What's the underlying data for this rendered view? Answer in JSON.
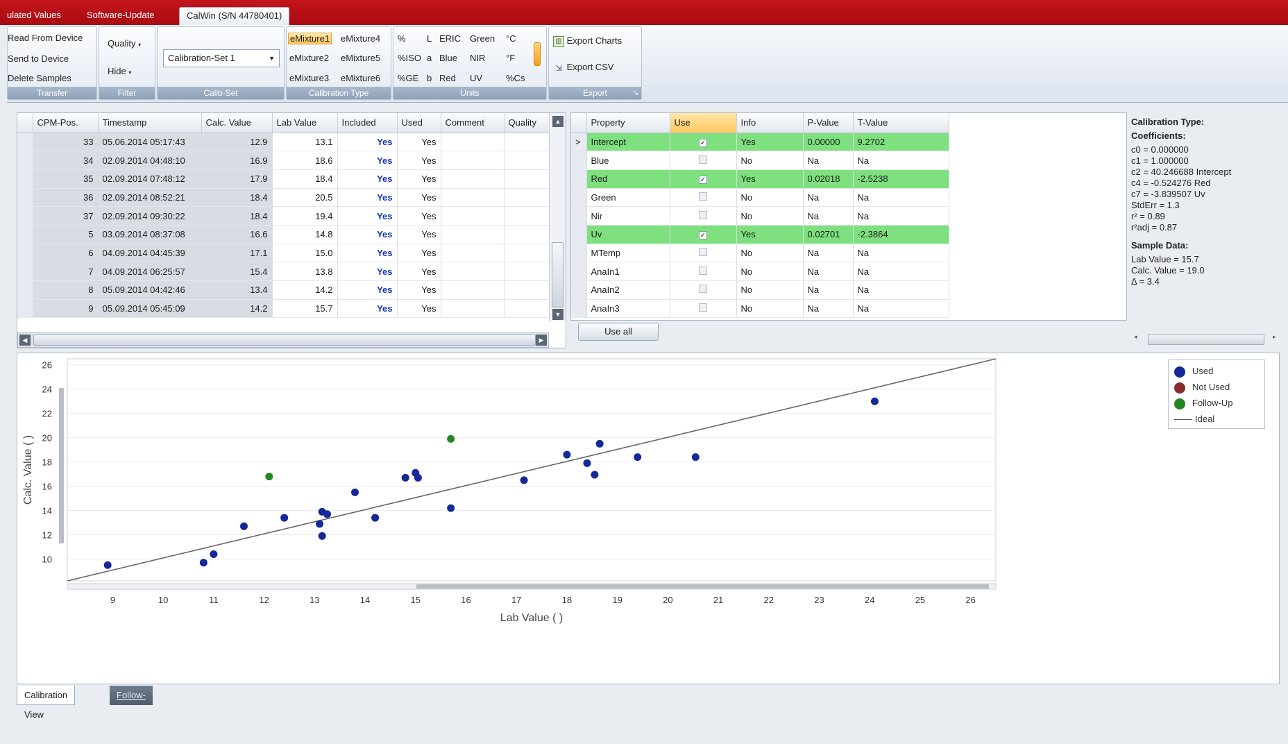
{
  "tabs": [
    {
      "label": "ulated Values"
    },
    {
      "label": "Software-Update"
    },
    {
      "label": "CalWin (S/N 44780401)"
    }
  ],
  "ribbon": {
    "transfer": {
      "items": [
        "Read From Device",
        "Send to Device",
        "Delete Samples"
      ],
      "label": "Transfer"
    },
    "filter": {
      "items": [
        "Quality",
        "Hide"
      ],
      "label": "Filter"
    },
    "calibset": {
      "value": "Calibration-Set 1",
      "label": "Calib-Set"
    },
    "caltype": {
      "items": [
        "eMixture1",
        "eMixture4",
        "eMixture2",
        "eMixture5",
        "eMixture3",
        "eMixture6"
      ],
      "label": "Calibration Type"
    },
    "units": {
      "col1": [
        "%",
        "%ISO",
        "%GE"
      ],
      "col2": [
        "L",
        "a",
        "b"
      ],
      "col3": [
        "ERIC",
        "Blue",
        "Red"
      ],
      "col4": [
        "Green",
        "NIR",
        "UV"
      ],
      "col5": [
        "°C",
        "°F",
        "%Cs"
      ],
      "label": "Units"
    },
    "export": {
      "charts": "Export Charts",
      "csv": "Export CSV",
      "label": "Export"
    }
  },
  "samples": {
    "headers": [
      "CPM-Pos.",
      "Timestamp",
      "Calc. Value",
      "Lab Value",
      "Included",
      "Used",
      "Comment",
      "Quality"
    ],
    "rows": [
      {
        "pos": "33",
        "ts": "05.06.2014 05:17:43",
        "calc": "12.9",
        "lab": "13.1",
        "inc": "Yes",
        "used": "Yes"
      },
      {
        "pos": "34",
        "ts": "02.09.2014 04:48:10",
        "calc": "16.9",
        "lab": "18.6",
        "inc": "Yes",
        "used": "Yes"
      },
      {
        "pos": "35",
        "ts": "02.09.2014 07:48:12",
        "calc": "17.9",
        "lab": "18.4",
        "inc": "Yes",
        "used": "Yes"
      },
      {
        "pos": "36",
        "ts": "02.09.2014 08:52:21",
        "calc": "18.4",
        "lab": "20.5",
        "inc": "Yes",
        "used": "Yes"
      },
      {
        "pos": "37",
        "ts": "02.09.2014 09:30:22",
        "calc": "18.4",
        "lab": "19.4",
        "inc": "Yes",
        "used": "Yes"
      },
      {
        "pos": "5",
        "ts": "03.09.2014 08:37:08",
        "calc": "16.6",
        "lab": "14.8",
        "inc": "Yes",
        "used": "Yes"
      },
      {
        "pos": "6",
        "ts": "04.09.2014 04:45:39",
        "calc": "17.1",
        "lab": "15.0",
        "inc": "Yes",
        "used": "Yes"
      },
      {
        "pos": "7",
        "ts": "04.09.2014 06:25:57",
        "calc": "15.4",
        "lab": "13.8",
        "inc": "Yes",
        "used": "Yes"
      },
      {
        "pos": "8",
        "ts": "05.09.2014 04:42:46",
        "calc": "13.4",
        "lab": "14.2",
        "inc": "Yes",
        "used": "Yes"
      },
      {
        "pos": "9",
        "ts": "05.09.2014 05:45:09",
        "calc": "14.2",
        "lab": "15.7",
        "inc": "Yes",
        "used": "Yes"
      }
    ]
  },
  "properties": {
    "headers": [
      "Property",
      "Use",
      "Info",
      "P-Value",
      "T-Value"
    ],
    "rows": [
      {
        "name": "Intercept",
        "use": true,
        "info": "Yes",
        "p": "0.00000",
        "t": "9.2702",
        "hl": true,
        "cur": true
      },
      {
        "name": "Blue",
        "use": false,
        "info": "No",
        "p": "Na",
        "t": "Na",
        "hl": false
      },
      {
        "name": "Red",
        "use": true,
        "info": "Yes",
        "p": "0.02018",
        "t": "-2.5238",
        "hl": true
      },
      {
        "name": "Green",
        "use": false,
        "info": "No",
        "p": "Na",
        "t": "Na",
        "hl": false
      },
      {
        "name": "Nir",
        "use": false,
        "info": "No",
        "p": "Na",
        "t": "Na",
        "hl": false
      },
      {
        "name": "Uv",
        "use": true,
        "info": "Yes",
        "p": "0.02701",
        "t": "-2.3864",
        "hl": true
      },
      {
        "name": "MTemp",
        "use": false,
        "info": "No",
        "p": "Na",
        "t": "Na",
        "hl": false
      },
      {
        "name": "AnaIn1",
        "use": false,
        "info": "No",
        "p": "Na",
        "t": "Na",
        "hl": false
      },
      {
        "name": "AnaIn2",
        "use": false,
        "info": "No",
        "p": "Na",
        "t": "Na",
        "hl": false
      },
      {
        "name": "AnaIn3",
        "use": false,
        "info": "No",
        "p": "Na",
        "t": "Na",
        "hl": false
      }
    ],
    "use_all": "Use all"
  },
  "coefficients": {
    "title_type": "Calibration Type:",
    "title_coeff": "Coefficients:",
    "lines": [
      "c0 = 0.000000",
      "c1 = 1.000000",
      "c2 = 40.246688 Intercept",
      "c4 = -0.524276 Red",
      "c7 = -3.839507 Uv",
      "StdErr = 1.3",
      "r² = 0.89",
      "r²adj = 0.87"
    ],
    "title_sample": "Sample Data:",
    "sample_lines": [
      "Lab Value = 15.7",
      "Calc. Value = 19.0",
      "Δ = 3.4"
    ]
  },
  "legend": {
    "used": "Used",
    "not_used": "Not Used",
    "follow_up": "Follow-Up",
    "ideal": "Ideal"
  },
  "colors": {
    "used": "#14289a",
    "not_used": "#8b2a2a",
    "follow_up": "#22871f",
    "ideal": "#666666",
    "accent_red": "#c4141b"
  },
  "bottom_tabs": [
    "Calibration View",
    "Follow-Up View"
  ],
  "chart_data": {
    "type": "scatter",
    "xlabel": "Lab Value ( )",
    "ylabel": "Calc. Value ( )",
    "xlim": [
      8.1,
      26.5
    ],
    "ylim": [
      8.2,
      26.5
    ],
    "xticks": [
      9,
      10,
      11,
      12,
      13,
      14,
      15,
      16,
      17,
      18,
      19,
      20,
      21,
      22,
      23,
      24,
      25,
      26
    ],
    "yticks": [
      10,
      12,
      14,
      16,
      18,
      20,
      22,
      24,
      26
    ],
    "series": [
      {
        "name": "Used",
        "points": [
          [
            8.9,
            9.5
          ],
          [
            10.8,
            9.7
          ],
          [
            11.0,
            10.4
          ],
          [
            11.6,
            12.7
          ],
          [
            12.4,
            13.4
          ],
          [
            13.1,
            12.9
          ],
          [
            13.15,
            11.9
          ],
          [
            13.15,
            13.9
          ],
          [
            13.25,
            13.7
          ],
          [
            13.8,
            15.5
          ],
          [
            14.2,
            13.4
          ],
          [
            14.8,
            16.7
          ],
          [
            15.0,
            17.1
          ],
          [
            15.05,
            16.7
          ],
          [
            15.7,
            14.2
          ],
          [
            17.15,
            16.5
          ],
          [
            18.0,
            18.6
          ],
          [
            18.4,
            17.9
          ],
          [
            18.55,
            16.95
          ],
          [
            18.65,
            19.5
          ],
          [
            19.4,
            18.4
          ],
          [
            20.55,
            18.4
          ],
          [
            24.1,
            23.0
          ]
        ]
      },
      {
        "name": "Follow-Up",
        "points": [
          [
            12.1,
            16.8
          ],
          [
            15.7,
            19.9
          ]
        ]
      }
    ],
    "ideal_line": [
      [
        8.1,
        8.2
      ],
      [
        26.5,
        26.5
      ]
    ],
    "grid": true,
    "legend_position": "top-right"
  }
}
